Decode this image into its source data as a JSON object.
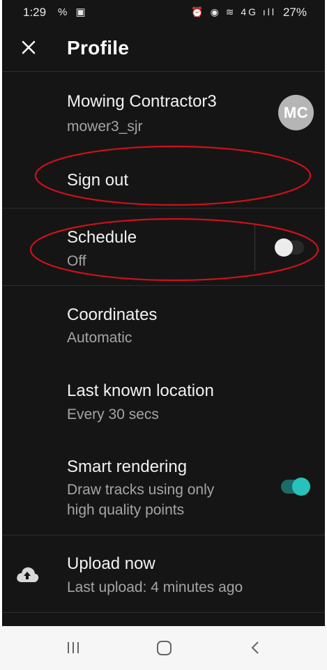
{
  "status_bar": {
    "time": "1:29",
    "left_icons": "% ▣",
    "right_icons": "⏰ ◉ ≋ 4G ıll",
    "battery": "27%"
  },
  "app_bar": {
    "title": "Profile"
  },
  "account": {
    "name": "Mowing Contractor3",
    "username": "mower3_sjr",
    "avatar_initials": "MC",
    "sign_out_label": "Sign out"
  },
  "settings": {
    "schedule": {
      "title": "Schedule",
      "value": "Off",
      "enabled": false
    },
    "coordinates": {
      "title": "Coordinates",
      "value": "Automatic"
    },
    "last_location": {
      "title": "Last known location",
      "value": "Every 30 secs"
    },
    "smart_rendering": {
      "title": "Smart rendering",
      "desc_line1": "Draw tracks using only",
      "desc_line2": "high quality points",
      "enabled": true
    },
    "upload": {
      "title": "Upload now",
      "value": "Last upload: 4 minutes ago"
    }
  },
  "colors": {
    "accent": "#27c2bb",
    "annotation": "#d0101a",
    "background": "#151515"
  },
  "icons": [
    "close-icon",
    "avatar",
    "cloud-upload-icon",
    "recents-icon",
    "home-icon",
    "back-icon"
  ]
}
